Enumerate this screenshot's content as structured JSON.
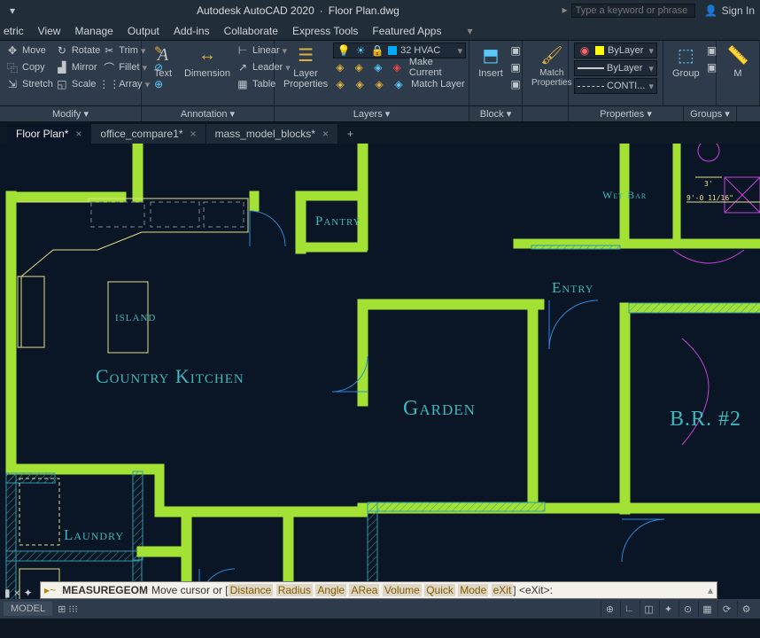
{
  "title": {
    "app": "Autodesk AutoCAD 2020",
    "filename": "Floor Plan.dwg",
    "search_placeholder": "Type a keyword or phrase",
    "signin": "Sign In"
  },
  "menubar": [
    "etric",
    "View",
    "Manage",
    "Output",
    "Add-ins",
    "Collaborate",
    "Express Tools",
    "Featured Apps"
  ],
  "ribbon": {
    "modify": {
      "label": "Modify ▾",
      "items": [
        "Move",
        "Copy",
        "Stretch",
        "Rotate",
        "Mirror",
        "Scale",
        "Trim",
        "Fillet",
        "Array"
      ]
    },
    "annotation": {
      "label": "Annotation ▾",
      "text": "Text",
      "dim": "Dimension",
      "table": "Table",
      "linear": "Linear",
      "leader": "Leader"
    },
    "layers": {
      "label": "Layers ▾",
      "lp": "Layer Properties",
      "current": "32 HVAC",
      "make": "Make Current",
      "match": "Match Layer"
    },
    "block": {
      "label": "Block ▾",
      "insert": "Insert"
    },
    "match_props": {
      "label": "Match Properties"
    },
    "properties": {
      "label": "Properties ▾",
      "l1": "ByLayer",
      "l2": "ByLayer",
      "l3": "CONTI..."
    },
    "groups": {
      "label": "Groups ▾",
      "group": "Group"
    }
  },
  "tabs": [
    {
      "label": "Floor Plan*",
      "active": true
    },
    {
      "label": "office_compare1*",
      "active": false
    },
    {
      "label": "mass_model_blocks*",
      "active": false
    }
  ],
  "rooms": {
    "kitchen": "Country Kitchen",
    "pantry": "Pantry",
    "garden": "Garden",
    "entry": "Entry",
    "island": "ISLAND",
    "laundry": "Laundry",
    "wetbar": "Wet Bar",
    "br2": "B.R. #2",
    "dim1": "3'",
    "dim2": "9'-0 11/16\""
  },
  "cmd": {
    "name": "MEASUREGEOM",
    "body": "Move cursor or [",
    "opts": [
      "Distance",
      "Radius",
      "Angle",
      "ARea",
      "Volume",
      "Quick",
      "Mode",
      "eXit"
    ],
    "tail": "] <eXit>:"
  },
  "status": {
    "model": "MODEL"
  }
}
